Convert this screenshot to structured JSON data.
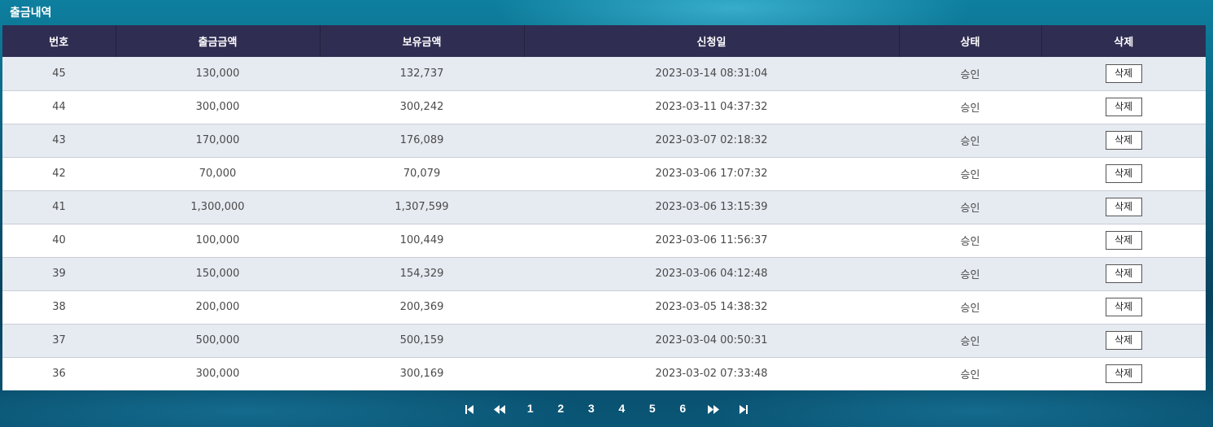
{
  "page_title": "출금내역",
  "table": {
    "headers": [
      "번호",
      "출금금액",
      "보유금액",
      "신청일",
      "상태",
      "삭제"
    ],
    "rows": [
      {
        "no": "45",
        "withdraw": "130,000",
        "balance": "132,737",
        "date": "2023-03-14 08:31:04",
        "status": "승인",
        "delete": "삭제"
      },
      {
        "no": "44",
        "withdraw": "300,000",
        "balance": "300,242",
        "date": "2023-03-11 04:37:32",
        "status": "승인",
        "delete": "삭제"
      },
      {
        "no": "43",
        "withdraw": "170,000",
        "balance": "176,089",
        "date": "2023-03-07 02:18:32",
        "status": "승인",
        "delete": "삭제"
      },
      {
        "no": "42",
        "withdraw": "70,000",
        "balance": "70,079",
        "date": "2023-03-06 17:07:32",
        "status": "승인",
        "delete": "삭제"
      },
      {
        "no": "41",
        "withdraw": "1,300,000",
        "balance": "1,307,599",
        "date": "2023-03-06 13:15:39",
        "status": "승인",
        "delete": "삭제"
      },
      {
        "no": "40",
        "withdraw": "100,000",
        "balance": "100,449",
        "date": "2023-03-06 11:56:37",
        "status": "승인",
        "delete": "삭제"
      },
      {
        "no": "39",
        "withdraw": "150,000",
        "balance": "154,329",
        "date": "2023-03-06 04:12:48",
        "status": "승인",
        "delete": "삭제"
      },
      {
        "no": "38",
        "withdraw": "200,000",
        "balance": "200,369",
        "date": "2023-03-05 14:38:32",
        "status": "승인",
        "delete": "삭제"
      },
      {
        "no": "37",
        "withdraw": "500,000",
        "balance": "500,159",
        "date": "2023-03-04 00:50:31",
        "status": "승인",
        "delete": "삭제"
      },
      {
        "no": "36",
        "withdraw": "300,000",
        "balance": "300,169",
        "date": "2023-03-02 07:33:48",
        "status": "승인",
        "delete": "삭제"
      }
    ]
  },
  "pagination": {
    "pages": [
      "1",
      "2",
      "3",
      "4",
      "5",
      "6"
    ],
    "icons": [
      "first-page-icon",
      "prev-page-icon",
      "next-page-icon",
      "last-page-icon"
    ]
  },
  "colors": {
    "header_bg": "#2f2d52",
    "row_odd": "#e6eaf1",
    "row_even": "#ffffff"
  }
}
